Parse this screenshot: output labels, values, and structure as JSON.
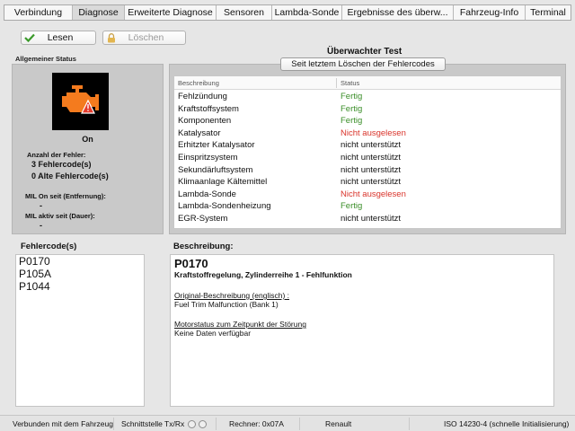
{
  "tabs": [
    {
      "label": "Verbindung"
    },
    {
      "label": "Diagnose"
    },
    {
      "label": "Erweiterte Diagnose"
    },
    {
      "label": "Sensoren"
    },
    {
      "label": "Lambda-Sonde"
    },
    {
      "label": "Ergebnisse des überw..."
    },
    {
      "label": "Fahrzeug-Info"
    },
    {
      "label": "Terminal"
    }
  ],
  "active_tab": "Diagnose",
  "toolbar": {
    "read_label": "Lesen",
    "clear_label": "Löschen"
  },
  "status": {
    "title": "Allgemeiner Status",
    "mil_state": "On",
    "fault_count_label": "Anzahl der Fehler:",
    "current_codes": "3 Fehlercode(s)",
    "old_codes": "0 Alte Fehlercode(s)",
    "mil_distance_label": "MIL On seit (Entfernung):",
    "mil_distance_value": "-",
    "mil_duration_label": "MIL aktiv seit (Dauer):",
    "mil_duration_value": "-"
  },
  "monitored_test": {
    "title": "Überwachter Test",
    "clear_since_button": "Seit letztem Löschen der Fehlercodes",
    "col_description": "Beschreibung",
    "col_status": "Status",
    "rows": [
      {
        "desc": "Fehlzündung",
        "status": "Fertig",
        "color": "#3a8e28"
      },
      {
        "desc": "Kraftstoffsystem",
        "status": "Fertig",
        "color": "#3a8e28"
      },
      {
        "desc": "Komponenten",
        "status": "Fertig",
        "color": "#3a8e28"
      },
      {
        "desc": "Katalysator",
        "status": "Nicht ausgelesen",
        "color": "#d9342b"
      },
      {
        "desc": "Erhitzter Katalysator",
        "status": "nicht unterstützt",
        "color": "#111111"
      },
      {
        "desc": "Einspritzsystem",
        "status": "nicht unterstützt",
        "color": "#111111"
      },
      {
        "desc": "Sekundärluftsystem",
        "status": "nicht unterstützt",
        "color": "#111111"
      },
      {
        "desc": "Klimaanlage Kältemittel",
        "status": "nicht unterstützt",
        "color": "#111111"
      },
      {
        "desc": "Lambda-Sonde",
        "status": "Nicht ausgelesen",
        "color": "#d9342b"
      },
      {
        "desc": "Lambda-Sondenheizung",
        "status": "Fertig",
        "color": "#3a8e28"
      },
      {
        "desc": "EGR-System",
        "status": "nicht unterstützt",
        "color": "#111111"
      }
    ]
  },
  "fault_codes": {
    "title": "Fehlercode(s)",
    "items": [
      "P0170",
      "P105A",
      "P1044"
    ]
  },
  "description": {
    "title": "Beschreibung:",
    "code": "P0170",
    "subtitle": "Kraftstoffregelung, Zylinderreihe 1 - Fehlfunktion",
    "orig_label": "Original-Beschreibung (englisch) :",
    "orig_text": "Fuel Trim Malfunction (Bank 1)",
    "engine_label": "Motorstatus zum Zeitpunkt der Störung",
    "engine_text": "Keine Daten verfügbar"
  },
  "statusbar": {
    "connection": "Verbunden mit dem Fahrzeug",
    "interface": "Schnittstelle Tx/Rx",
    "ecu": "Rechner: 0x07A",
    "make": "Renault",
    "protocol": "ISO 14230-4 (schnelle Initialisierung)"
  },
  "colors": {
    "ok": "#3a8e28",
    "error": "#d9342b",
    "engine_icon": "#f47b1e"
  }
}
